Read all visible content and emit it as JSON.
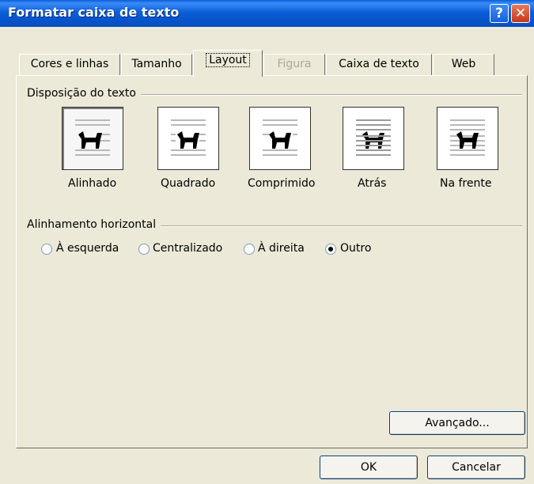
{
  "window": {
    "title": "Formatar caixa de texto"
  },
  "titlebar_buttons": {
    "help": "?",
    "close": "✕"
  },
  "tabs": [
    {
      "label": "Cores e linhas",
      "state": "normal"
    },
    {
      "label": "Tamanho",
      "state": "normal"
    },
    {
      "label": "Layout",
      "state": "active"
    },
    {
      "label": "Figura",
      "state": "disabled"
    },
    {
      "label": "Caixa de texto",
      "state": "normal"
    },
    {
      "label": "Web",
      "state": "normal"
    }
  ],
  "wrapping": {
    "group_label": "Disposição do texto",
    "options": [
      {
        "label": "Alinhado",
        "icon": "wrap-inline-icon",
        "selected": true
      },
      {
        "label": "Quadrado",
        "icon": "wrap-square-icon",
        "selected": false
      },
      {
        "label": "Comprimido",
        "icon": "wrap-tight-icon",
        "selected": false
      },
      {
        "label": "Atrás",
        "icon": "wrap-behind-icon",
        "selected": false
      },
      {
        "label": "Na frente",
        "icon": "wrap-front-icon",
        "selected": false
      }
    ]
  },
  "alignment": {
    "group_label": "Alinhamento horizontal",
    "options": [
      {
        "label": "À esquerda",
        "checked": false
      },
      {
        "label": "Centralizado",
        "checked": false
      },
      {
        "label": "À direita",
        "checked": false
      },
      {
        "label": "Outro",
        "checked": true
      }
    ]
  },
  "buttons": {
    "advanced": "Avançado...",
    "ok": "OK",
    "cancel": "Cancelar"
  },
  "colors": {
    "titlebar": "#0A5FD8",
    "dialog_bg": "#ECE9D8"
  }
}
